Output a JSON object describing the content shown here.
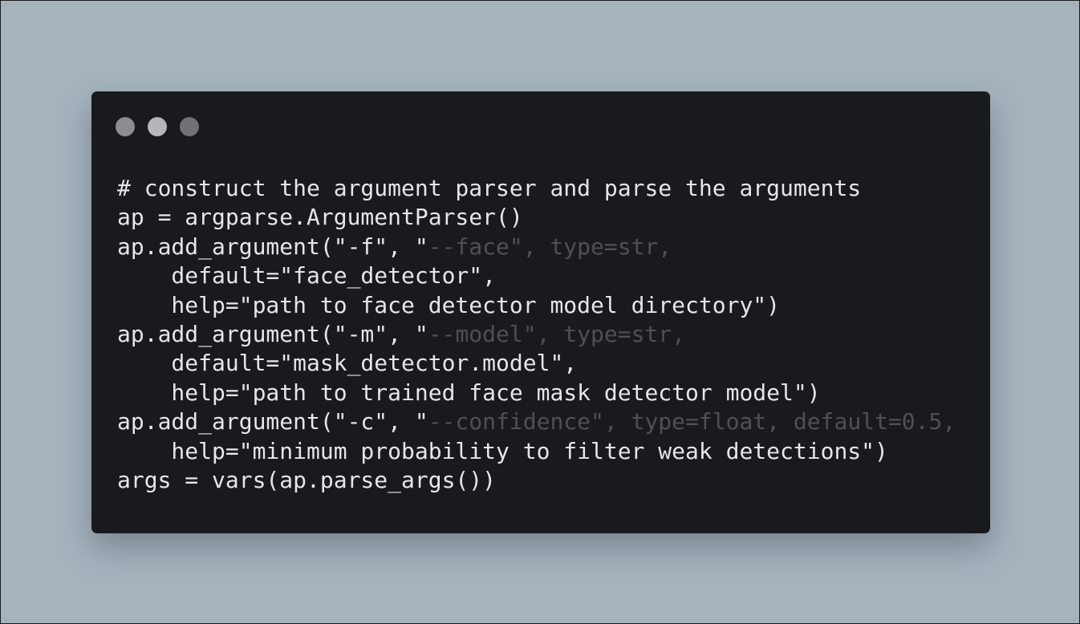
{
  "window": {
    "title": "",
    "controls": [
      "close",
      "minimize",
      "maximize"
    ]
  },
  "code": {
    "language": "python",
    "lines": [
      [
        {
          "t": "# construct the argument parser and parse the arguments",
          "c": "comment"
        }
      ],
      [
        {
          "t": "ap = argparse.ArgumentParser()",
          "c": "text"
        }
      ],
      [
        {
          "t": "ap.add_argument(\"-f\", \"",
          "c": "text"
        },
        {
          "t": "--face\", type=str,",
          "c": "dim"
        }
      ],
      [
        {
          "t": "    default=\"face_detector\",",
          "c": "text"
        }
      ],
      [
        {
          "t": "    help=\"path to face detector model directory\")",
          "c": "text"
        }
      ],
      [
        {
          "t": "ap.add_argument(\"-m\", \"",
          "c": "text"
        },
        {
          "t": "--model\", type=str,",
          "c": "dim"
        }
      ],
      [
        {
          "t": "    default=\"mask_detector.model\",",
          "c": "text"
        }
      ],
      [
        {
          "t": "    help=\"path to trained face mask detector model\")",
          "c": "text"
        }
      ],
      [
        {
          "t": "ap.add_argument(\"-c\", \"",
          "c": "text"
        },
        {
          "t": "--confidence\", type=float, default=0.5,",
          "c": "dim"
        }
      ],
      [
        {
          "t": "    help=\"minimum probability to filter weak detections\")",
          "c": "text"
        }
      ],
      [
        {
          "t": "args = vars(ap.parse_args())",
          "c": "text"
        }
      ]
    ]
  },
  "colors": {
    "page_background": "#a6b3bd",
    "window_background": "#181a1d",
    "code_text": "#e4e6e8",
    "code_dim": "#4d5156",
    "dot_close": "#8a8d92",
    "dot_minimize": "#b3b6ba",
    "dot_maximize": "#6f7277"
  }
}
